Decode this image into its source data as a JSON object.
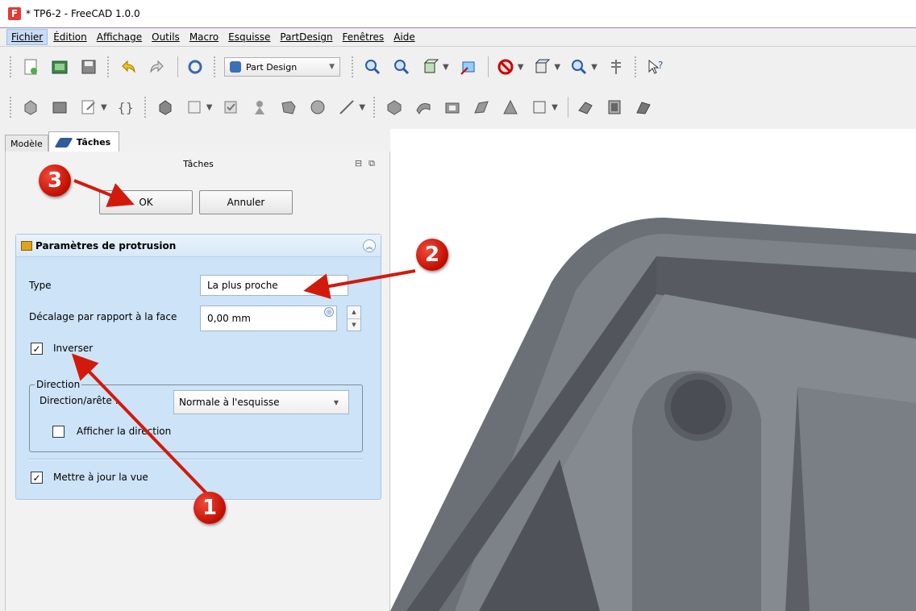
{
  "window": {
    "title": "* TP6-2 - FreeCAD 1.0.0",
    "logo_letter": "F"
  },
  "menu": [
    "Fichier",
    "Édition",
    "Affichage",
    "Outils",
    "Macro",
    "Esquisse",
    "PartDesign",
    "Fenêtres",
    "Aide"
  ],
  "toolbar": {
    "workbench": "Part Design",
    "icons_row1": [
      "new-file-icon",
      "open-file-icon",
      "save-icon",
      "undo-icon",
      "redo-icon",
      "refresh-icon",
      "zoom-fit-icon",
      "zoom-selection-icon",
      "view-cube-icon",
      "measure-icon",
      "no-draw-style-icon",
      "std-views-icon",
      "zoom-icon",
      "caliper-icon",
      "whats-this-icon"
    ],
    "icons_row2": [
      "body-icon",
      "folder-icon",
      "datum-icon",
      "brackets-icon",
      "shape-binder-icon",
      "sub-shape-icon",
      "clone-icon",
      "sketch-icon",
      "pad-icon",
      "revolution-icon",
      "loft-icon",
      "pipe-icon",
      "pocket-icon",
      "groove-icon",
      "subtractive-loft-icon",
      "chamfer-icon",
      "fillet-icon",
      "draft-icon",
      "thickness-icon"
    ]
  },
  "tabs": {
    "model": "Modèle",
    "tasks": "Tâches"
  },
  "panel": {
    "header": "Tâches",
    "ok": "OK",
    "cancel": "Annuler",
    "box_title": "Paramètres de protrusion",
    "type_label": "Type",
    "type_value": "La plus proche",
    "offset_label": "Décalage par rapport à la face",
    "offset_value": "0,00 mm",
    "reverse_label": "Inverser",
    "reverse_checked": true,
    "direction_group": "Direction",
    "direction_edge_label": "Direction/arête :",
    "direction_edge_value": "Normale à l'esquisse",
    "show_direction_label": "Afficher la direction",
    "show_direction_checked": false,
    "update_view_label": "Mettre à jour la vue",
    "update_view_checked": true
  },
  "callouts": [
    "1",
    "2",
    "3"
  ],
  "colors": {
    "callout": "#d21a0c",
    "panel_blue": "#cde3f7",
    "model_gray": "#7e838a"
  }
}
